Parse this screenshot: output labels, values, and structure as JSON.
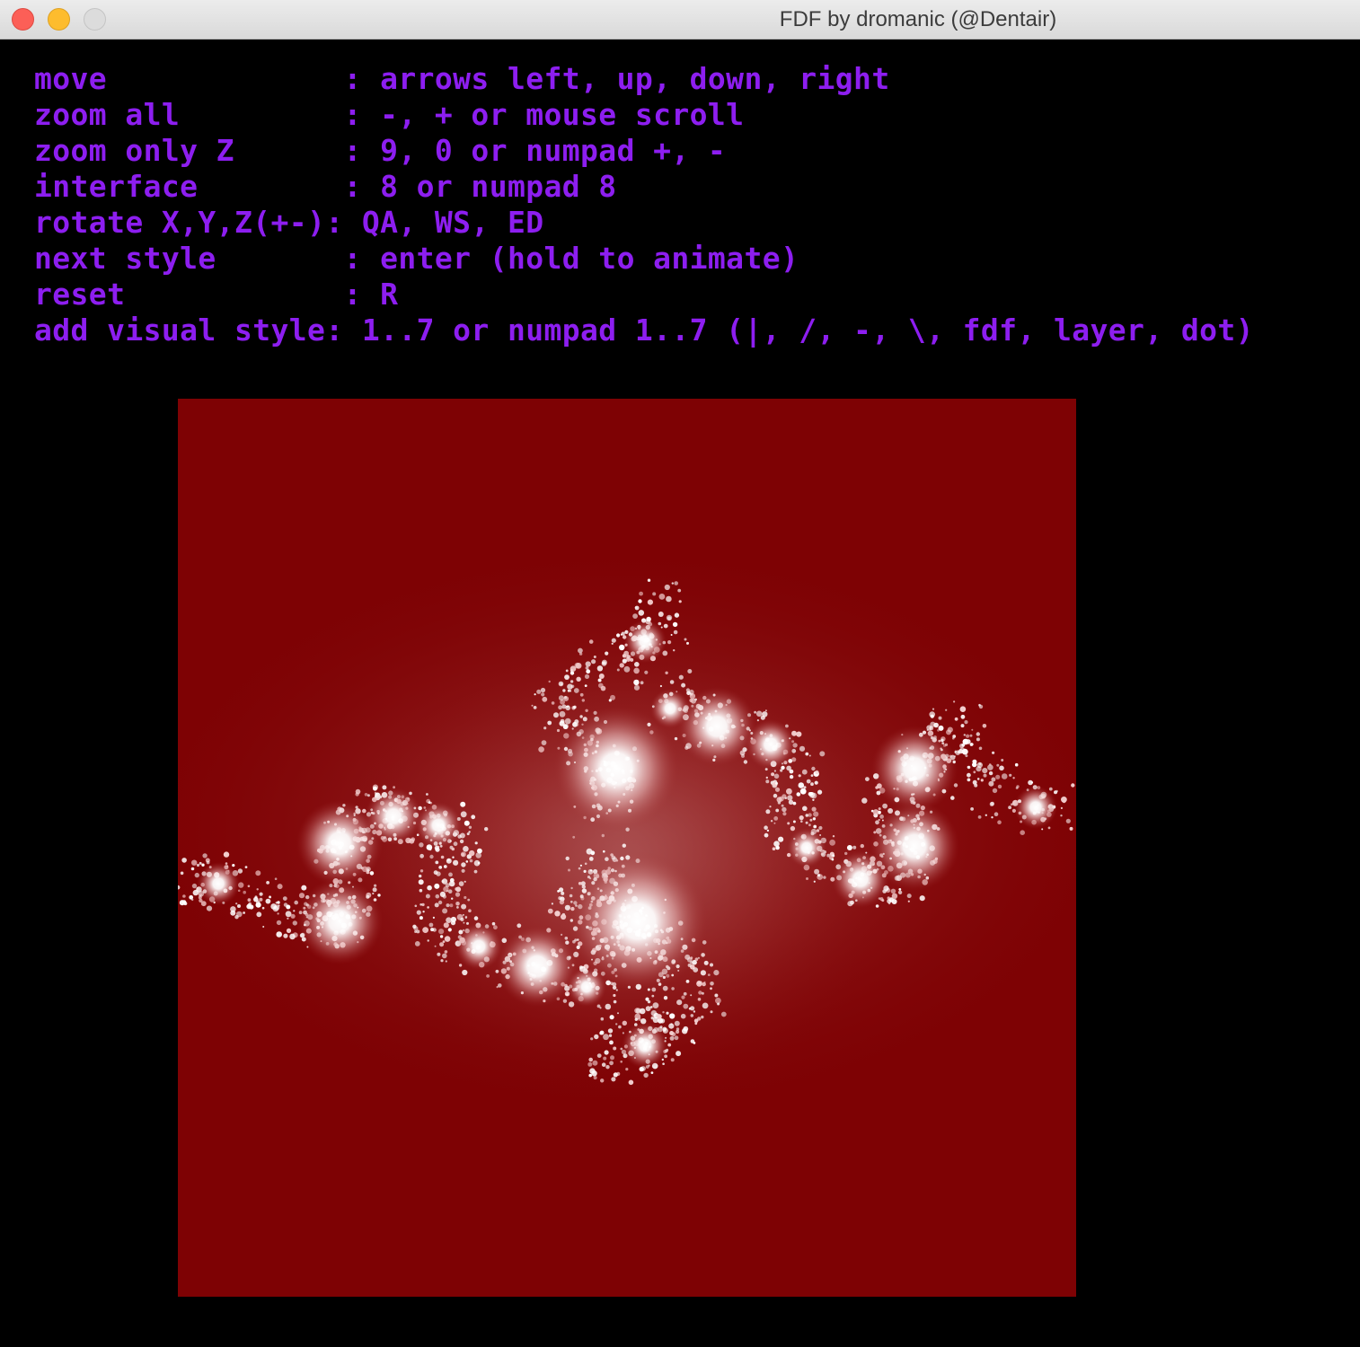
{
  "window": {
    "title": "FDF by dromanic (@Dentair)"
  },
  "help": {
    "lines": [
      "move             : arrows left, up, down, right",
      "zoom all         : -, + or mouse scroll",
      "zoom only Z      : 9, 0 or numpad +, -",
      "interface        : 8 or numpad 8",
      "rotate X,Y,Z(+-): QA, WS, ED",
      "next style       : enter (hold to animate)",
      "reset            : R",
      "add visual style: 1..7 or numpad 1..7 (|, /, -, \\, fdf, layer, dot)"
    ]
  },
  "colors": {
    "help_text": "#8d1ef0",
    "viewport_background": "#7e0204",
    "fractal_core": "#ffffff"
  },
  "viewport": {
    "content": "julia-set-fractal"
  }
}
